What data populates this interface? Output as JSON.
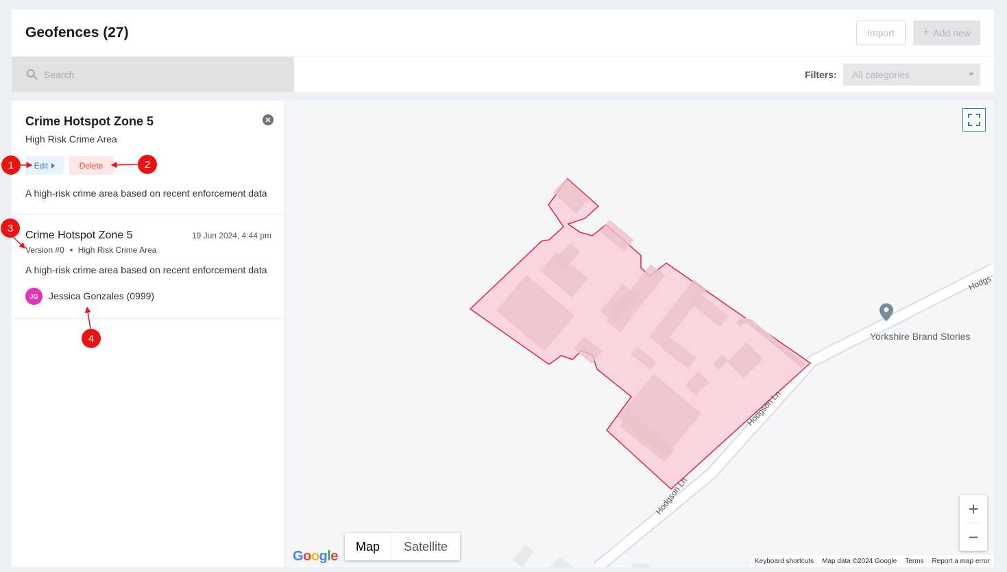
{
  "header": {
    "title": "Geofences (27)",
    "import_label": "Import",
    "add_label": "Add new",
    "add_icon": "plus-icon"
  },
  "toolbar": {
    "search_placeholder": "Search",
    "filters_label": "Filters:",
    "filter_value": "All categories"
  },
  "detail": {
    "title": "Crime Hotspot Zone 5",
    "category": "High Risk Crime Area",
    "edit_label": "Edit",
    "delete_label": "Delete",
    "description": "A high-risk crime area based on recent enforcement data"
  },
  "version": {
    "title": "Crime Hotspot Zone 5",
    "date": "19 Jun 2024, 4:44 pm",
    "version_label": "Version #0",
    "category": "High Risk Crime Area",
    "description": "A high-risk crime area based on recent enforcement data",
    "author_initials": "JG",
    "author_name": "Jessica Gonzales (0999)"
  },
  "map": {
    "poi_name": "Yorkshire Brand Stories",
    "road_name_1": "Hodgson Ln",
    "road_name_2": "Hodgson Ln",
    "road_name_3": "Hodgs",
    "maptype_map": "Map",
    "maptype_satellite": "Satellite",
    "zoom_in": "+",
    "zoom_out": "−",
    "attribution": {
      "shortcuts": "Keyboard shortcuts",
      "data": "Map data ©2024 Google",
      "terms": "Terms",
      "report": "Report a map error"
    },
    "geofence_fill": "#f9d3da",
    "geofence_stroke": "#e8214a"
  },
  "annotations": {
    "m1": "1",
    "m2": "2",
    "m3": "3",
    "m4": "4",
    "color": "#ee1111"
  }
}
